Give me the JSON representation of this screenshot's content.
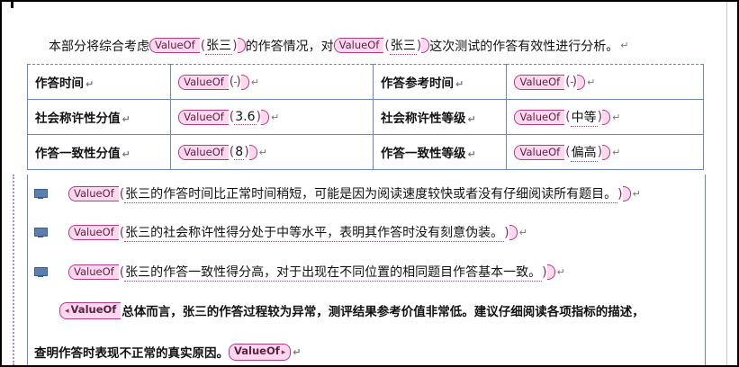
{
  "field_code": "ValueOf",
  "para_mark": "↵",
  "intro": {
    "text_before": "本部分将综合考虑",
    "name_1": "张三",
    "text_middle": "的作答情况，对",
    "name_2": "张三",
    "text_after": "这次测试的作答有效性进行分析。"
  },
  "table": {
    "rows": [
      {
        "label_1": "作答时间",
        "value_1": "",
        "label_2": "作答参考时间",
        "value_2": ""
      },
      {
        "label_1": "社会称许性分值",
        "value_1": "3.6",
        "label_2": "社会称许性等级",
        "value_2": "中等"
      },
      {
        "label_1": "作答一致性分值",
        "value_1": "8",
        "label_2": "作答一致性等级",
        "value_2": "偏高"
      }
    ]
  },
  "items": [
    {
      "text": "张三的作答时间比正常时间稍短，可能是因为阅读速度较快或者没有仔细阅读所有题目。"
    },
    {
      "text": "张三的社会称许性得分处于中等水平，表明其作答时没有刻意伪装。"
    },
    {
      "text": "张三的作答一致性得分高，对于出现在不同位置的相同题目作答基本一致。"
    }
  ],
  "summary": {
    "line_1": "总体而言，张三的作答过程较为异常，测评结果参考价值非常低。建议仔细阅读各项指标的描述，",
    "line_2": "查明作答时表现不正常的真实原因。"
  }
}
